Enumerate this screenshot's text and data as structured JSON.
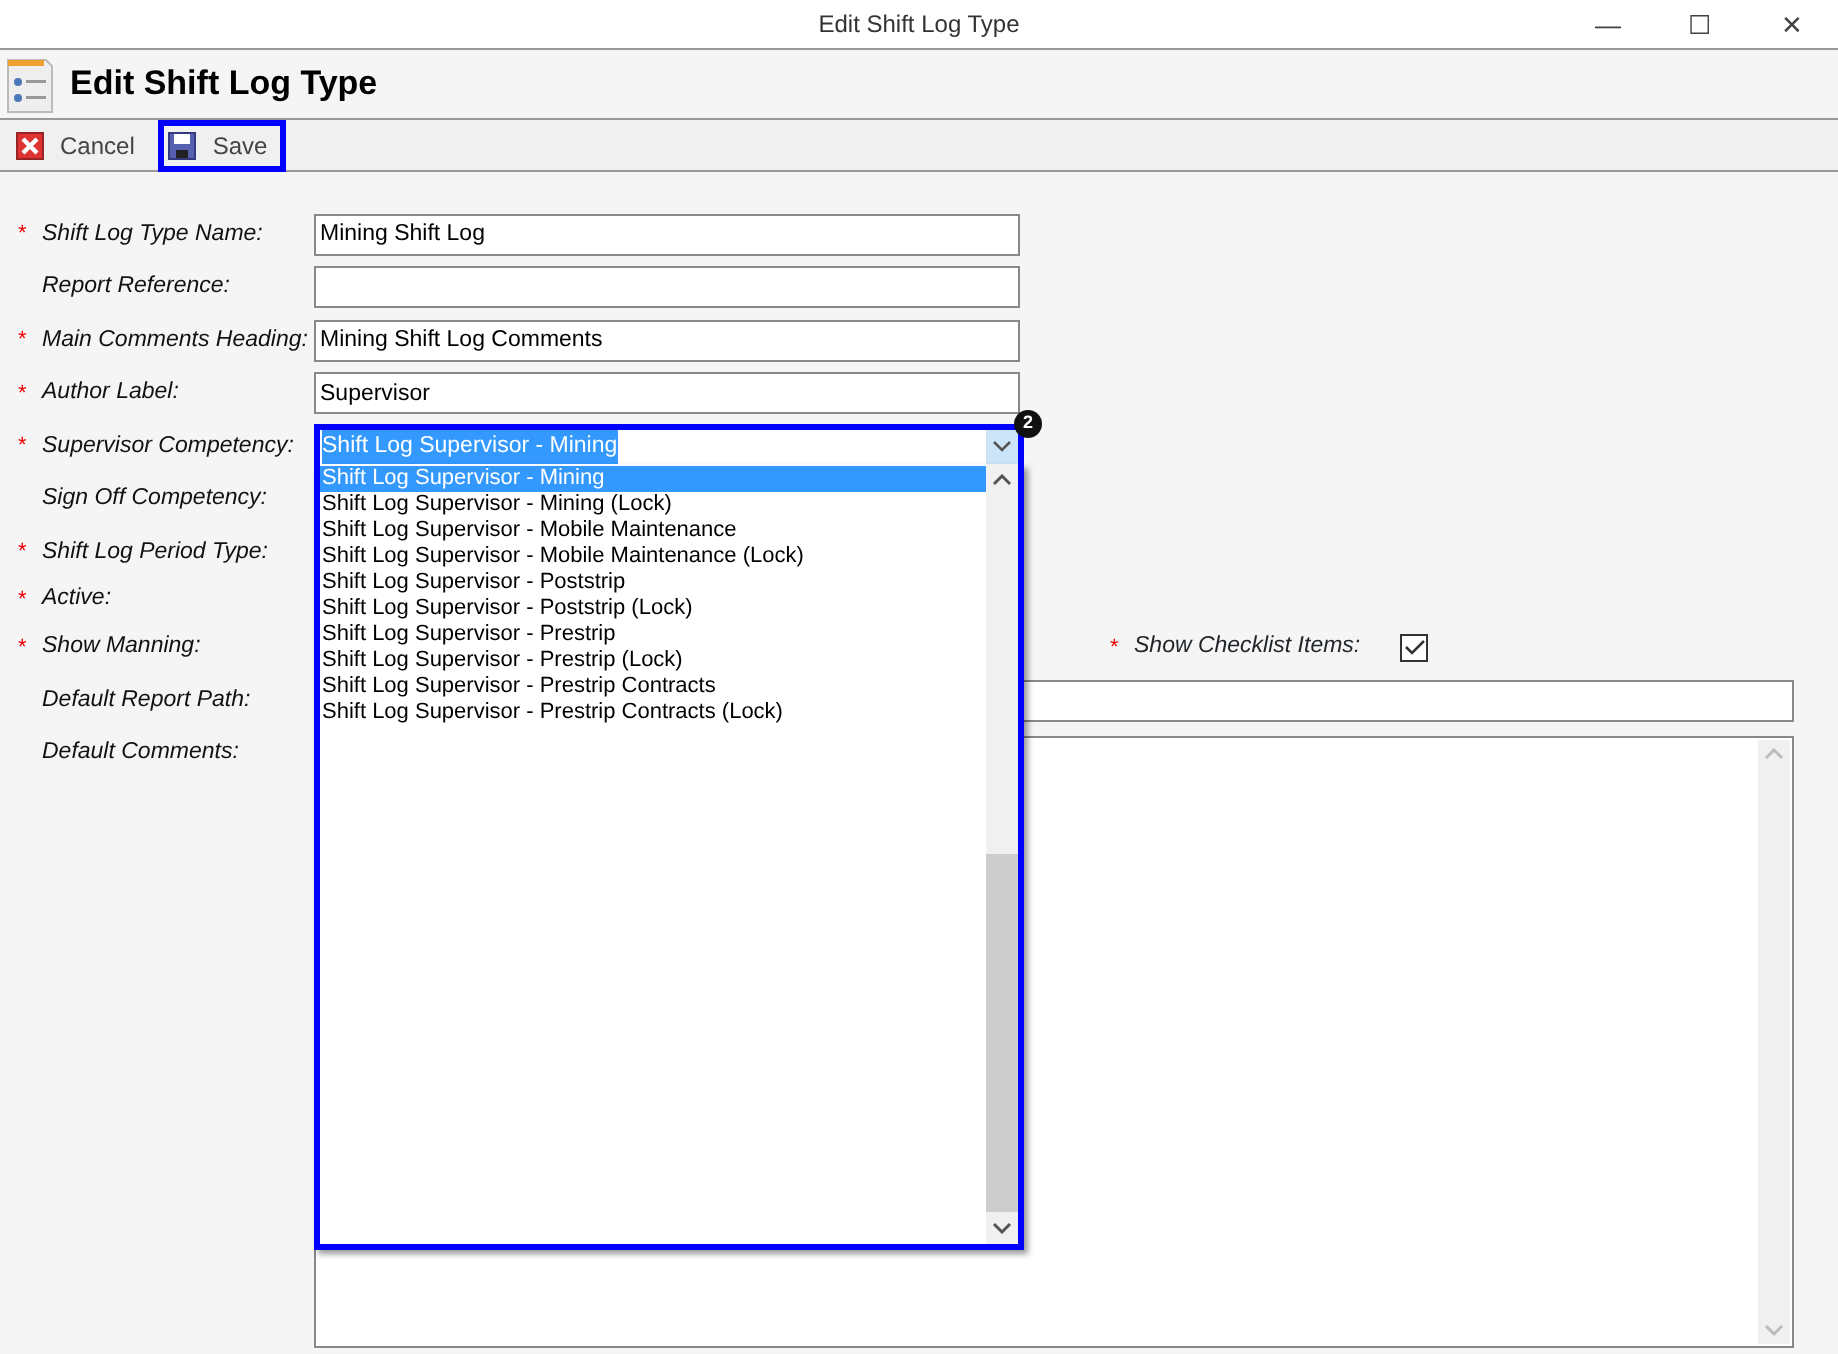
{
  "window": {
    "title": "Edit Shift Log Type",
    "controls": [
      "—",
      "☐",
      "✕"
    ]
  },
  "header": {
    "title": "Edit Shift Log Type"
  },
  "toolbar": [
    {
      "label": "Cancel",
      "kind": "cancel",
      "highlighted": false
    },
    {
      "label": "Save",
      "kind": "save",
      "highlighted": true
    }
  ],
  "form": [
    {
      "marker": "*",
      "label": "Shift Log Type Name:",
      "kind": "text",
      "value": "Mining Shift Log"
    },
    {
      "label": "Report Reference:",
      "kind": "text"
    },
    {
      "marker": "*",
      "label": "Main Comments Heading:",
      "kind": "text",
      "value": "Mining Shift Log Comments"
    },
    {
      "marker": "*",
      "label": "Author Label:",
      "kind": "text",
      "value": "Supervisor"
    },
    {
      "marker": "*",
      "label": "Supervisor Competency:",
      "kind": "dropdown",
      "value": "Shift Log Supervisor - Mining",
      "highlighted": true,
      "badge": "2",
      "options": [
        {
          "label": "Shift Log Supervisor - Mining",
          "selected": true
        },
        {
          "label": "Shift Log Supervisor - Mining (Lock)",
          "selected": false
        },
        {
          "label": "Shift Log Supervisor - Mobile Maintenance",
          "selected": false
        },
        {
          "label": "Shift Log Supervisor - Mobile Maintenance (Lock)",
          "selected": false
        },
        {
          "label": "Shift Log Supervisor - Poststrip",
          "selected": false
        },
        {
          "label": "Shift Log Supervisor - Poststrip (Lock)",
          "selected": false
        },
        {
          "label": "Shift Log Supervisor - Prestrip",
          "selected": false
        },
        {
          "label": "Shift Log Supervisor - Prestrip (Lock)",
          "selected": false
        },
        {
          "label": "Shift Log Supervisor - Prestrip Contracts",
          "selected": false
        },
        {
          "label": "Shift Log Supervisor - Prestrip Contracts (Lock)",
          "selected": false
        }
      ]
    },
    {
      "label": "Sign Off Competency:",
      "kind": "hidden"
    },
    {
      "marker": "*",
      "label": "Shift Log Period Type:",
      "kind": "hidden"
    },
    {
      "marker": "*",
      "label": "Active:",
      "kind": "hidden"
    },
    {
      "marker": "*",
      "label": "Show Manning:",
      "kind": "hidden",
      "side": {
        "marker": "*",
        "label": "Show Checklist Items:",
        "checked": true
      }
    },
    {
      "label": "Default Report Path:",
      "kind": "text"
    },
    {
      "label": "Default Comments:",
      "kind": "textarea"
    }
  ]
}
